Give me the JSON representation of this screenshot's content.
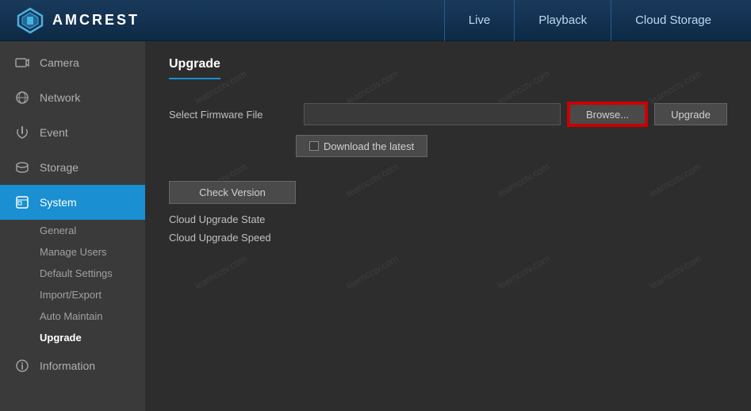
{
  "header": {
    "logo_text": "AMCREST",
    "nav": [
      {
        "label": "Live",
        "id": "live"
      },
      {
        "label": "Playback",
        "id": "playback"
      },
      {
        "label": "Cloud Storage",
        "id": "cloud-storage"
      }
    ]
  },
  "sidebar": {
    "items": [
      {
        "label": "Camera",
        "id": "camera",
        "icon": "camera"
      },
      {
        "label": "Network",
        "id": "network",
        "icon": "network"
      },
      {
        "label": "Event",
        "id": "event",
        "icon": "event"
      },
      {
        "label": "Storage",
        "id": "storage",
        "icon": "storage"
      },
      {
        "label": "System",
        "id": "system",
        "icon": "system",
        "active": true
      },
      {
        "label": "Information",
        "id": "information",
        "icon": "info"
      }
    ],
    "sub_items": [
      {
        "label": "General",
        "id": "general"
      },
      {
        "label": "Manage Users",
        "id": "manage-users"
      },
      {
        "label": "Default Settings",
        "id": "default-settings"
      },
      {
        "label": "Import/Export",
        "id": "import-export"
      },
      {
        "label": "Auto Maintain",
        "id": "auto-maintain"
      },
      {
        "label": "Upgrade",
        "id": "upgrade",
        "active": true
      }
    ]
  },
  "content": {
    "page_title": "Upgrade",
    "firmware_label": "Select Firmware File",
    "browse_label": "Browse...",
    "upgrade_label": "Upgrade",
    "download_label": "Download the latest",
    "check_version_label": "Check Version",
    "cloud_upgrade_state_label": "Cloud Upgrade State",
    "cloud_upgrade_speed_label": "Cloud Upgrade Speed",
    "watermark_text": "learncctv.com"
  }
}
